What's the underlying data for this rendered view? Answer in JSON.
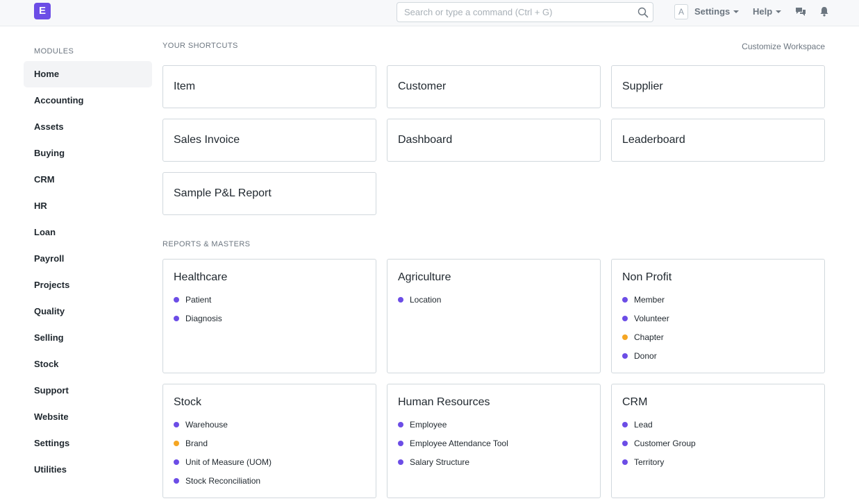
{
  "navbar": {
    "logo_letter": "E",
    "search_placeholder": "Search or type a command (Ctrl + G)",
    "avatar_letter": "A",
    "settings_label": "Settings",
    "help_label": "Help",
    "icons": [
      "search-icon",
      "chat-icon",
      "bell-icon"
    ]
  },
  "colors": {
    "brand": "#6c4de6",
    "dot_purple": "#6c4de6",
    "dot_orange": "#f5a623"
  },
  "sidebar": {
    "heading": "MODULES",
    "items": [
      {
        "label": "Home",
        "active": true
      },
      {
        "label": "Accounting"
      },
      {
        "label": "Assets"
      },
      {
        "label": "Buying"
      },
      {
        "label": "CRM"
      },
      {
        "label": "HR"
      },
      {
        "label": "Loan"
      },
      {
        "label": "Payroll"
      },
      {
        "label": "Projects"
      },
      {
        "label": "Quality"
      },
      {
        "label": "Selling"
      },
      {
        "label": "Stock"
      },
      {
        "label": "Support"
      },
      {
        "label": "Website"
      },
      {
        "label": "Settings"
      },
      {
        "label": "Utilities"
      }
    ]
  },
  "main": {
    "shortcuts_heading": "YOUR SHORTCUTS",
    "customize_label": "Customize Workspace",
    "shortcuts": [
      "Item",
      "Customer",
      "Supplier",
      "Sales Invoice",
      "Dashboard",
      "Leaderboard",
      "Sample P&L Report"
    ],
    "reports_heading": "REPORTS & MASTERS",
    "cards": [
      {
        "title": "Healthcare",
        "links": [
          {
            "label": "Patient",
            "color": "purple"
          },
          {
            "label": "Diagnosis",
            "color": "purple"
          }
        ]
      },
      {
        "title": "Agriculture",
        "links": [
          {
            "label": "Location",
            "color": "purple"
          }
        ]
      },
      {
        "title": "Non Profit",
        "links": [
          {
            "label": "Member",
            "color": "purple"
          },
          {
            "label": "Volunteer",
            "color": "purple"
          },
          {
            "label": "Chapter",
            "color": "orange"
          },
          {
            "label": "Donor",
            "color": "purple"
          }
        ]
      },
      {
        "title": "Stock",
        "links": [
          {
            "label": "Warehouse",
            "color": "purple"
          },
          {
            "label": "Brand",
            "color": "orange"
          },
          {
            "label": "Unit of Measure (UOM)",
            "color": "purple"
          },
          {
            "label": "Stock Reconciliation",
            "color": "purple"
          }
        ]
      },
      {
        "title": "Human Resources",
        "links": [
          {
            "label": "Employee",
            "color": "purple"
          },
          {
            "label": "Employee Attendance Tool",
            "color": "purple"
          },
          {
            "label": "Salary Structure",
            "color": "purple"
          }
        ]
      },
      {
        "title": "CRM",
        "links": [
          {
            "label": "Lead",
            "color": "purple"
          },
          {
            "label": "Customer Group",
            "color": "purple"
          },
          {
            "label": "Territory",
            "color": "purple"
          }
        ]
      }
    ]
  }
}
